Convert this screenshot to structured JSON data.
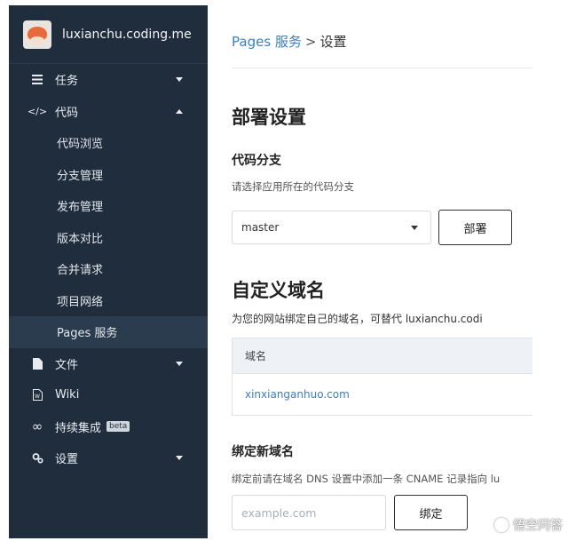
{
  "sidebar": {
    "brand": "luxianchu.coding.me",
    "items": [
      {
        "label": "任务",
        "icon": "list-icon",
        "expandable": true,
        "expanded": false
      },
      {
        "label": "代码",
        "icon": "code-icon",
        "expandable": true,
        "expanded": true
      },
      {
        "label": "文件",
        "icon": "file-icon",
        "expandable": true,
        "expanded": false
      },
      {
        "label": "Wiki",
        "icon": "wiki-icon",
        "expandable": false
      },
      {
        "label": "持续集成",
        "icon": "infinity-icon",
        "badge": "beta",
        "expandable": false
      },
      {
        "label": "设置",
        "icon": "gear-icon",
        "expandable": true,
        "expanded": false
      }
    ],
    "code_sub_items": [
      "代码浏览",
      "分支管理",
      "发布管理",
      "版本对比",
      "合并请求",
      "项目网络",
      "Pages 服务"
    ],
    "active_sub_item": "Pages 服务"
  },
  "breadcrumb": {
    "parent": "Pages 服务",
    "separator": ">",
    "current": "设置"
  },
  "deploy": {
    "title": "部署设置",
    "branch_title": "代码分支",
    "branch_desc": "请选择应用所在的代码分支",
    "branch_value": "master",
    "deploy_button": "部署"
  },
  "domain": {
    "title": "自定义域名",
    "desc": "为您的网站绑定自己的域名，可替代 luxianchu.codi",
    "table_header": "域名",
    "rows": [
      "xinxianganhuo.com"
    ]
  },
  "bind": {
    "title": "绑定新域名",
    "desc": "绑定前请在域名 DNS 设置中添加一条 CNAME 记录指向 lu",
    "placeholder": "example.com",
    "button": "绑定"
  },
  "watermark": "悟空问答",
  "colors": {
    "sidebar_bg": "#1f2d3d",
    "active_bg": "#2b3c4f",
    "link": "#3a7fc4"
  }
}
